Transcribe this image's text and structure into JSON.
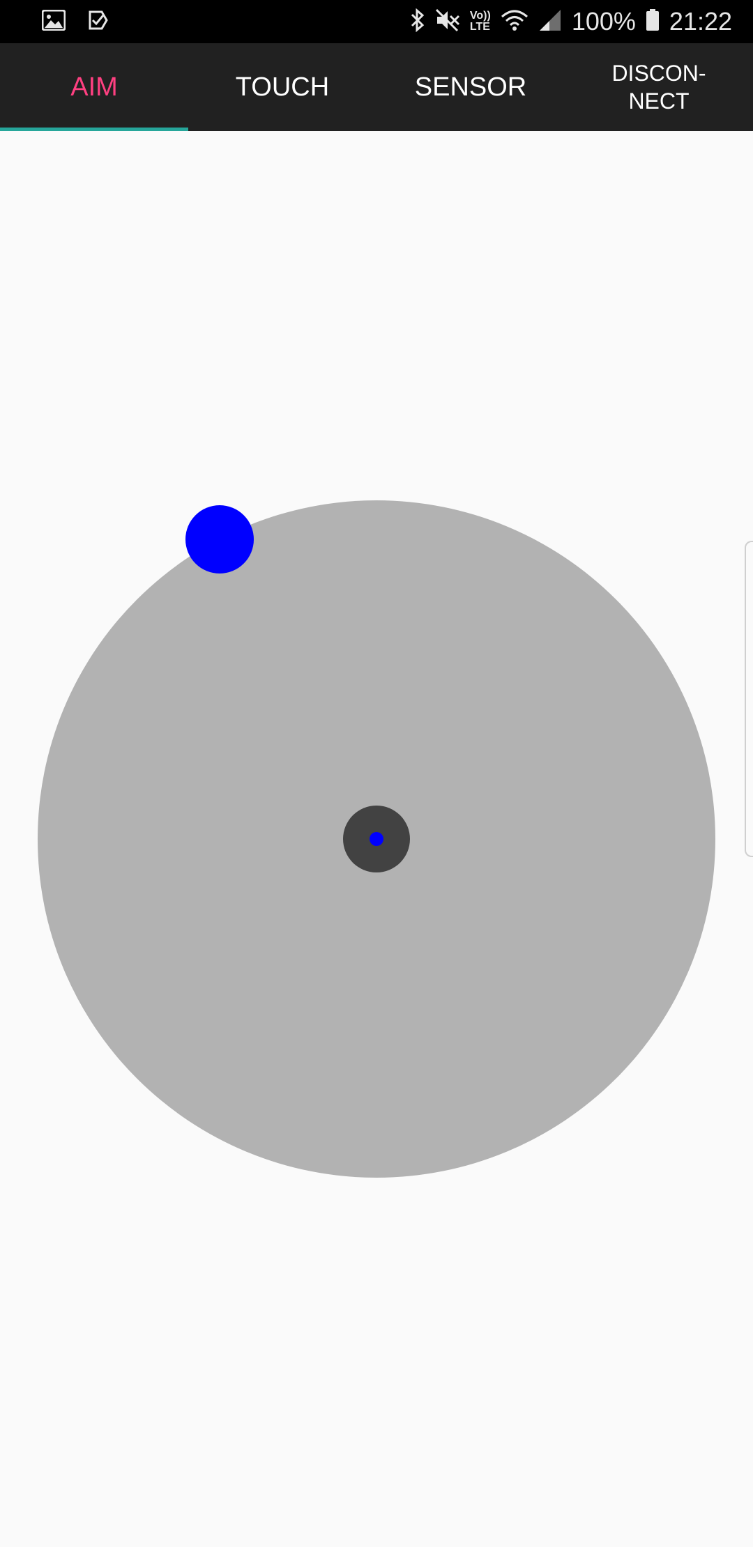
{
  "status_bar": {
    "left_icons": [
      "image-icon",
      "task-check-icon"
    ],
    "right_icons": [
      "bluetooth-icon",
      "mute-icon",
      "volte-icon",
      "wifi-icon",
      "signal-icon",
      "battery-icon"
    ],
    "volte_label": "Vo))\nLTE",
    "battery_percent": "100%",
    "time": "21:22"
  },
  "tabs": [
    {
      "label": "AIM",
      "active": true
    },
    {
      "label": "TOUCH",
      "active": false
    },
    {
      "label": "SENSOR",
      "active": false
    },
    {
      "label": "DISCON-\nNECT",
      "active": false
    }
  ],
  "colors": {
    "active_tab_text": "#ff4081",
    "tab_indicator": "#26a69a",
    "tab_bar_bg": "#212121",
    "pad": "#b2b2b2",
    "pad_center": "#424242",
    "knob": "#0000ff",
    "background": "#fafafa"
  }
}
